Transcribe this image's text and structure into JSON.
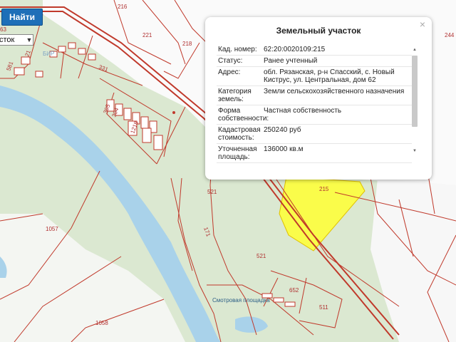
{
  "toolbar": {
    "find_label": "Найти",
    "type_select_value": "сток"
  },
  "popup": {
    "title": "Земельный участок",
    "close_symbol": "×",
    "rows": [
      {
        "label": "Кад. номер:",
        "value": "62:20:0020109:215"
      },
      {
        "label": "Статус:",
        "value": "Ранее учтенный"
      },
      {
        "label": "Адрес:",
        "value": "обл. Рязанская, р-н Спасский, с. Новый Киструс, ул. Центральная, дом 62"
      },
      {
        "label": "Категория земель:",
        "value": "Земли сельскохозяйственного назначения"
      },
      {
        "label": "Форма собственности:",
        "value": "Частная собственность"
      },
      {
        "label": "Кадастровая стоимость:",
        "value": "250240 руб"
      },
      {
        "label": "Уточненная площадь:",
        "value": "136000 кв.м"
      }
    ]
  },
  "map": {
    "colors": {
      "land": "#dbe8d1",
      "river": "#a9d2ea",
      "boundary": "#c0392b",
      "highlight": "#ffff33"
    },
    "labels": {
      "l216": "216",
      "l221": "221",
      "l218": "218",
      "l331": "331",
      "l395": "395",
      "l394": "394",
      "l1218": "1218",
      "l581": "581",
      "l21": "21",
      "l63": "63",
      "l1057": "1057",
      "l1058": "1058",
      "l521a": "521",
      "l521b": "521",
      "l171": "171",
      "l652": "652",
      "l511": "511",
      "l215": "215",
      "l244": "244",
      "village1": "БИР",
      "village2": "Смотровая площадка"
    }
  }
}
